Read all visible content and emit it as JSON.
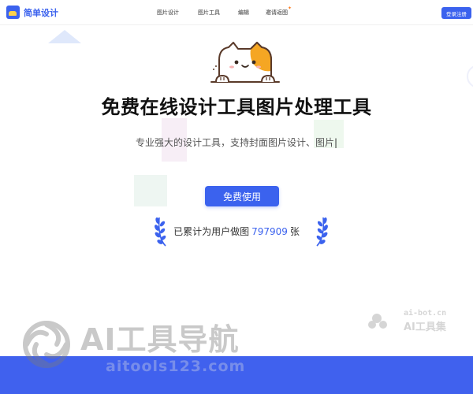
{
  "header": {
    "logo_text": "简单设计",
    "nav": [
      {
        "label": "图片设计"
      },
      {
        "label": "图片工具"
      },
      {
        "label": "编辑"
      },
      {
        "label": "邀请返图",
        "badge": "✦"
      }
    ],
    "login_label": "登录注册"
  },
  "hero": {
    "title": "免费在线设计工具图片处理工具",
    "subtitle": "专业强大的设计工具，支持封面图片设计、图片",
    "cta_label": "免费使用",
    "stats_prefix": "已累计为用户做图",
    "stats_count": "797909",
    "stats_suffix": "张"
  },
  "watermarks": {
    "small_url": "ai-bot.cn",
    "small_name": "AI工具集",
    "big_name": "AI工具导航",
    "big_url": "aitools123.com"
  },
  "colors": {
    "accent": "#3b62ee",
    "footer": "#4061ee",
    "mascot_orange": "#f5a623"
  },
  "icons": [
    "logo-icon",
    "cat-mascot-icon",
    "laurel-left-icon",
    "laurel-right-icon"
  ]
}
